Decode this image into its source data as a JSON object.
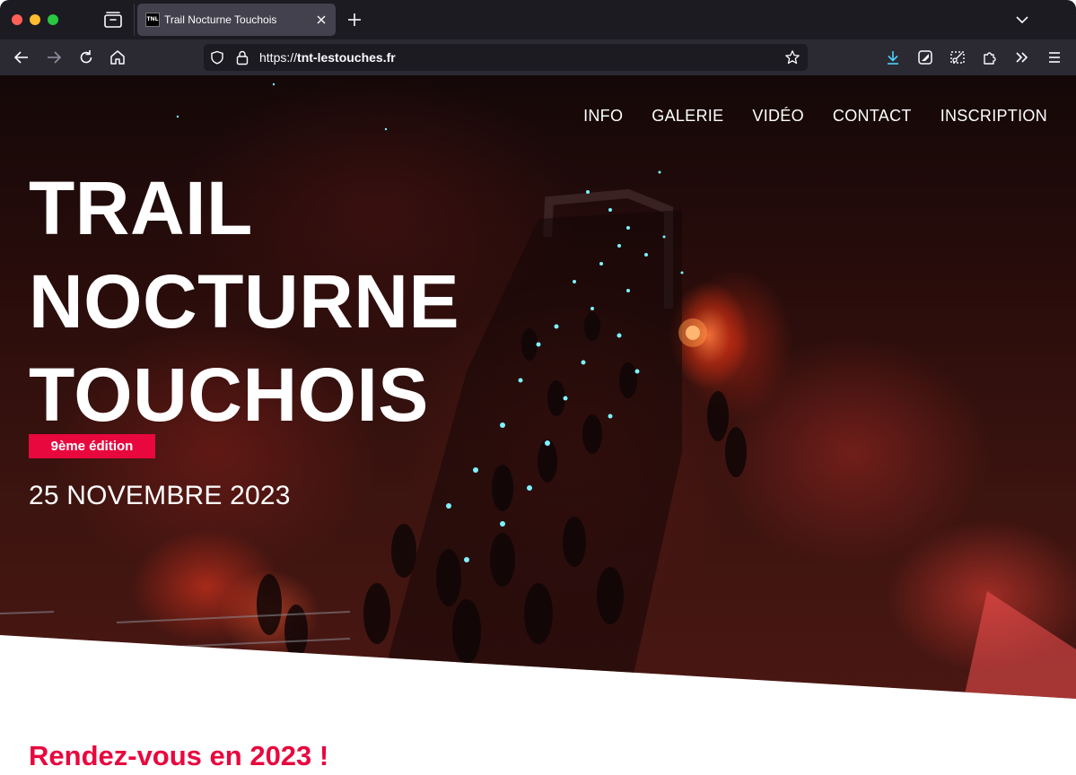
{
  "browser": {
    "tab_title": "Trail Nocturne Touchois",
    "tab_favicon_text": "TNL",
    "url_prefix": "https://",
    "url_domain": "tnt-lestouches.fr",
    "icons": [
      "tab-overview-icon",
      "close-icon",
      "plus-icon",
      "chevron-down-icon",
      "back-arrow-icon",
      "forward-arrow-icon",
      "reload-icon",
      "home-icon",
      "shield-icon",
      "lock-icon",
      "star-icon",
      "download-icon",
      "extension-square-icon",
      "screenshot-icon",
      "puzzle-icon",
      "chevrons-right-icon",
      "hamburger-menu-icon"
    ]
  },
  "nav": {
    "items": [
      {
        "label": "INFO"
      },
      {
        "label": "GALERIE"
      },
      {
        "label": "VIDÉO"
      },
      {
        "label": "CONTACT"
      },
      {
        "label": "INSCRIPTION"
      }
    ]
  },
  "hero": {
    "title_lines": [
      "TRAIL",
      "NOCTURNE",
      "TOUCHOIS"
    ],
    "edition": "9ème édition",
    "date": "25 NOVEMBRE 2023"
  },
  "section": {
    "heading_prefix": "Rendez-vous en ",
    "heading_year": "2023",
    "heading_suffix": " !"
  },
  "colors": {
    "accent": "#e8083e",
    "browser_dark": "#1c1b22",
    "toolbar": "#2b2a33",
    "tab_active": "#42414d",
    "download_icon": "#4fd1ff"
  }
}
